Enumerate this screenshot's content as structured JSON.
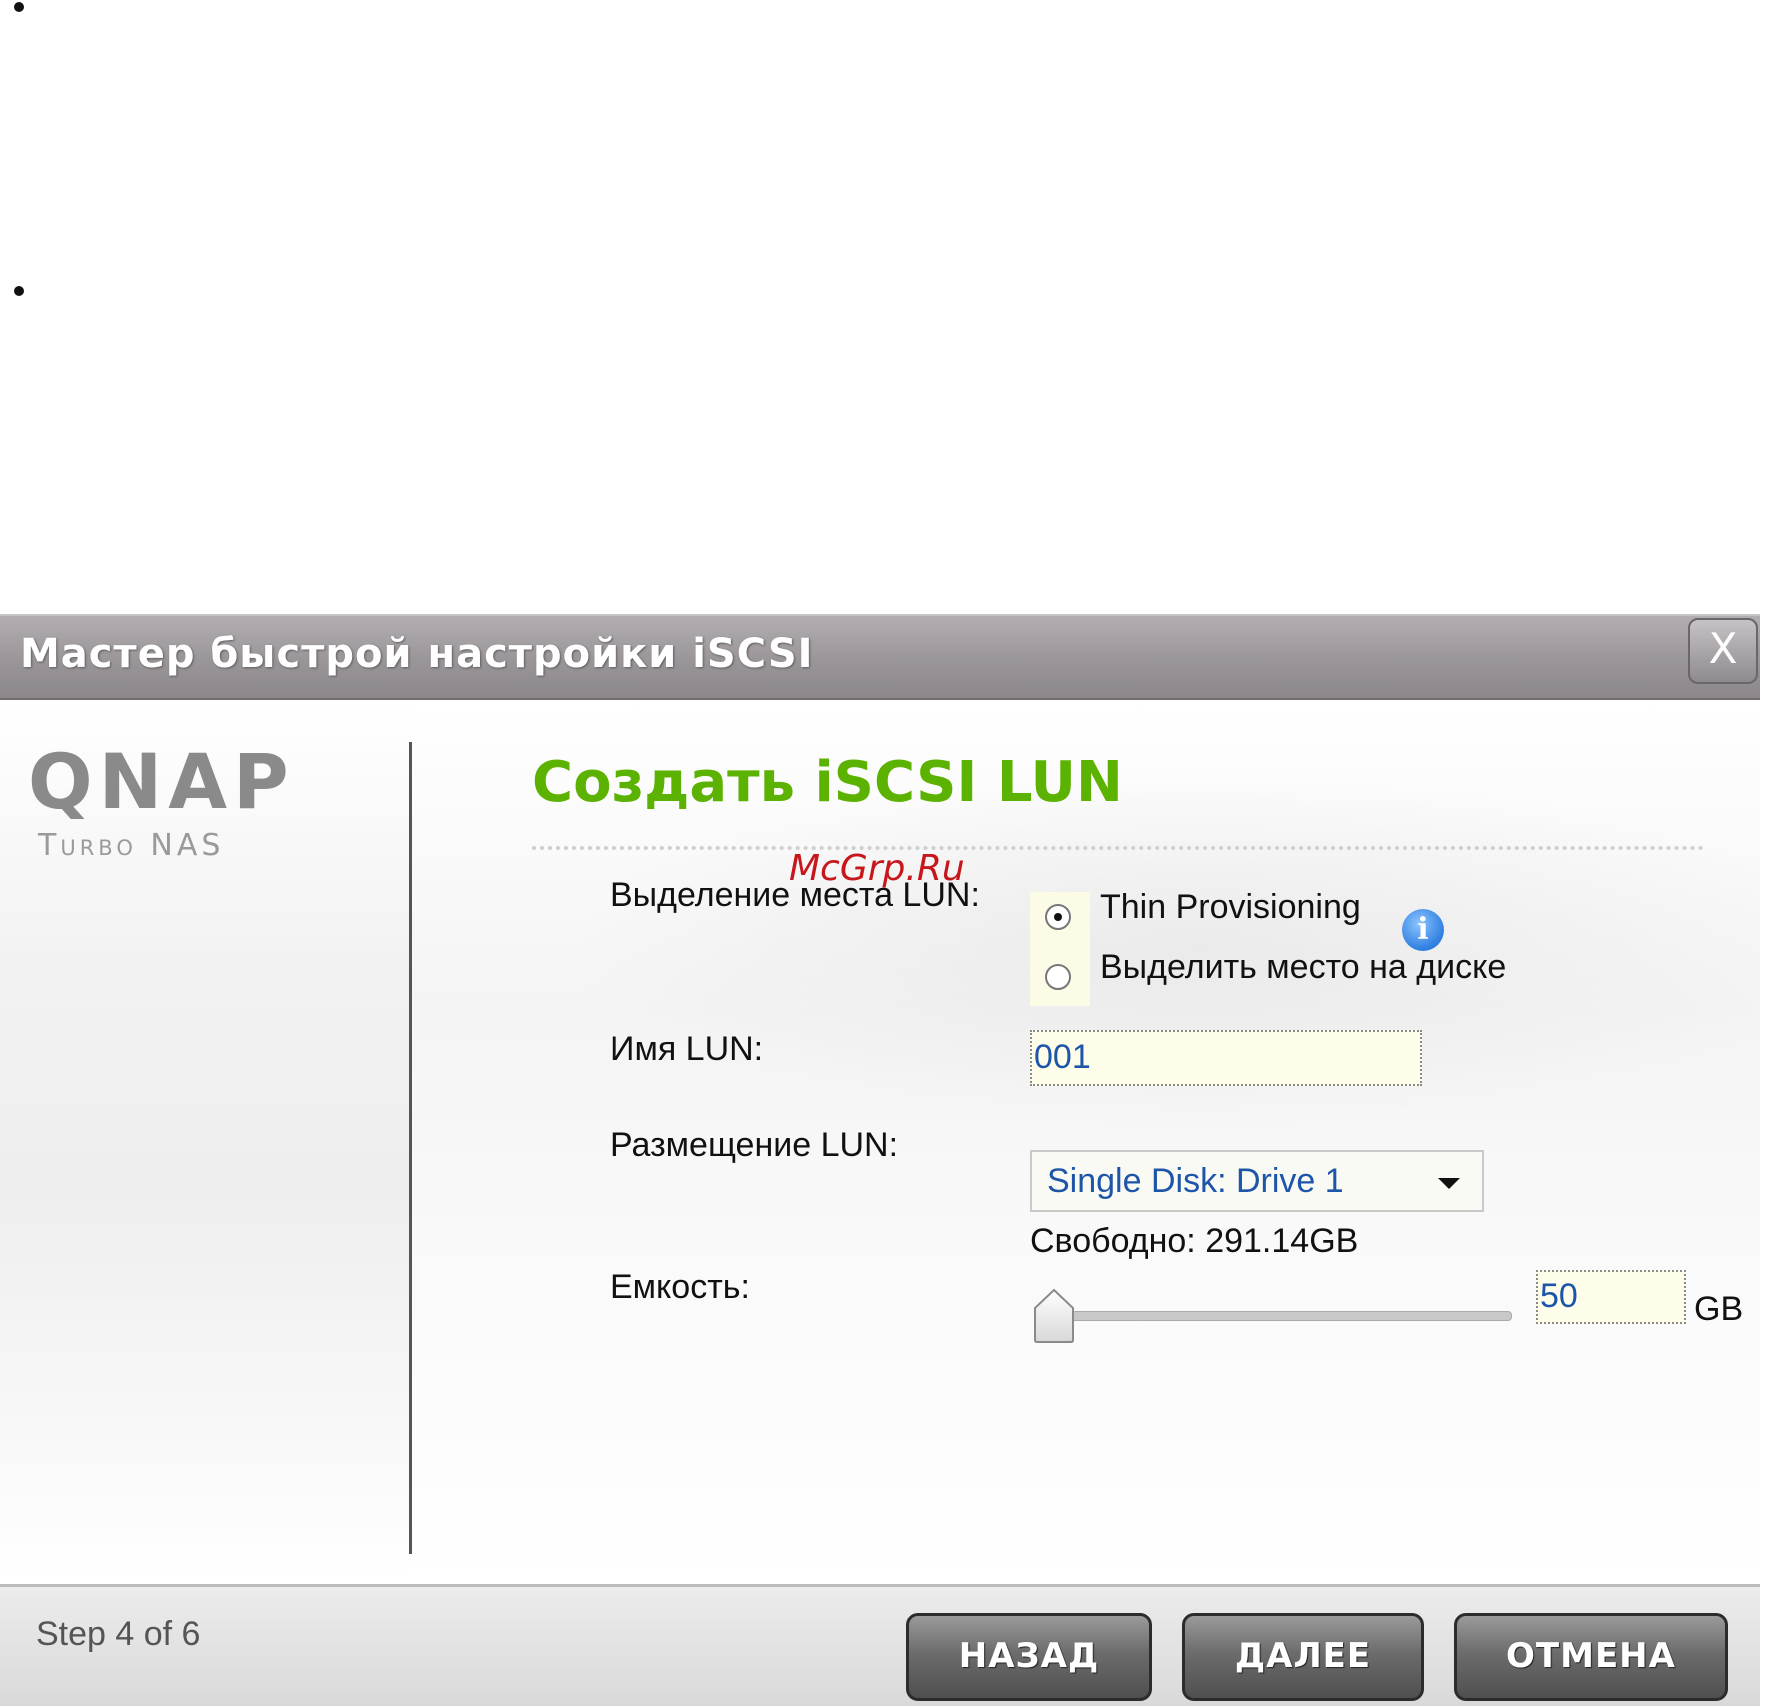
{
  "window": {
    "title": "Мастер быстрой настройки iSCSI",
    "close_label": "X"
  },
  "brand": {
    "logo": "QNAP",
    "subtitle": "Turbo NAS"
  },
  "watermark": "McGrp.Ru",
  "page": {
    "heading": "Создать iSCSI LUN"
  },
  "form": {
    "allocation": {
      "label": "Выделение места LUN:",
      "options": [
        {
          "label": "Thin Provisioning",
          "selected": true
        },
        {
          "label": "Выделить место на диске",
          "selected": false
        }
      ],
      "info_icon": "info-icon"
    },
    "lun_name": {
      "label": "Имя LUN:",
      "value": "001"
    },
    "location": {
      "label": "Размещение LUN:",
      "selected": "Single Disk: Drive 1",
      "free": "Свободно: 291.14GB"
    },
    "capacity": {
      "label": "Емкость:",
      "value": "50",
      "unit": "GB",
      "slider_position": 0.0
    }
  },
  "footer": {
    "step": "Step 4 of 6",
    "buttons": {
      "back": "НАЗАД",
      "next": "ДАЛЕЕ",
      "cancel": "ОТМЕНА"
    }
  },
  "colors": {
    "heading": "#5cb200",
    "input_text": "#1d55a8",
    "watermark": "#c8161d"
  }
}
